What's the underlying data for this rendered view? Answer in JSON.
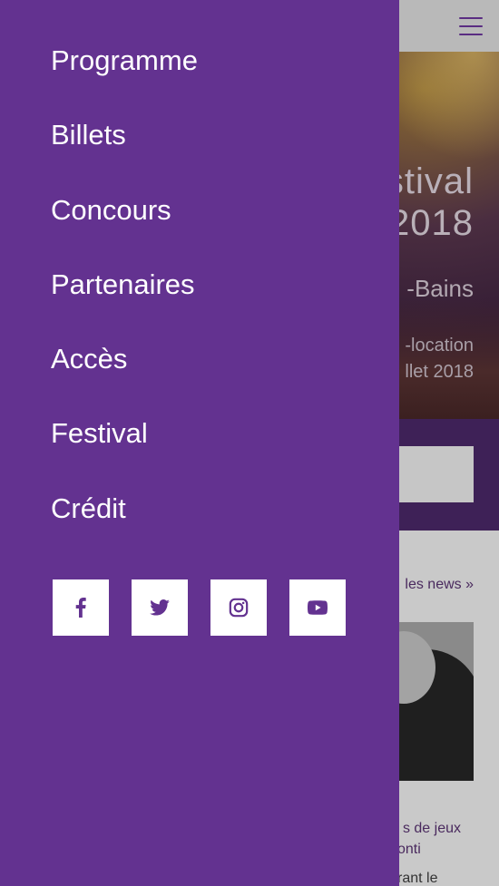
{
  "drawer": {
    "menu": [
      {
        "id": "programme",
        "label": "Programme"
      },
      {
        "id": "billets",
        "label": "Billets"
      },
      {
        "id": "concours",
        "label": "Concours"
      },
      {
        "id": "partenaires",
        "label": "Partenaires"
      },
      {
        "id": "acces",
        "label": "Accès"
      },
      {
        "id": "festival",
        "label": "Festival"
      },
      {
        "id": "credit",
        "label": "Crédit"
      }
    ],
    "socials": [
      {
        "name": "facebook-icon"
      },
      {
        "name": "twitter-icon"
      },
      {
        "name": "instagram-icon"
      },
      {
        "name": "youtube-icon"
      }
    ],
    "colors": {
      "background": "#633290",
      "text": "#ffffff",
      "icon": "#633290"
    }
  },
  "background_page": {
    "header": {
      "menu_icon": "hamburger-icon"
    },
    "hero": {
      "title_line1": "stival",
      "title_line2": "2018",
      "subtitle": "-Bains",
      "line1": "-location",
      "line2": "llet 2018"
    },
    "news": {
      "all_news_link": "les news »",
      "title_line1": "s de jeux",
      "title_line2": "onti",
      "snippet": "rant le"
    }
  }
}
